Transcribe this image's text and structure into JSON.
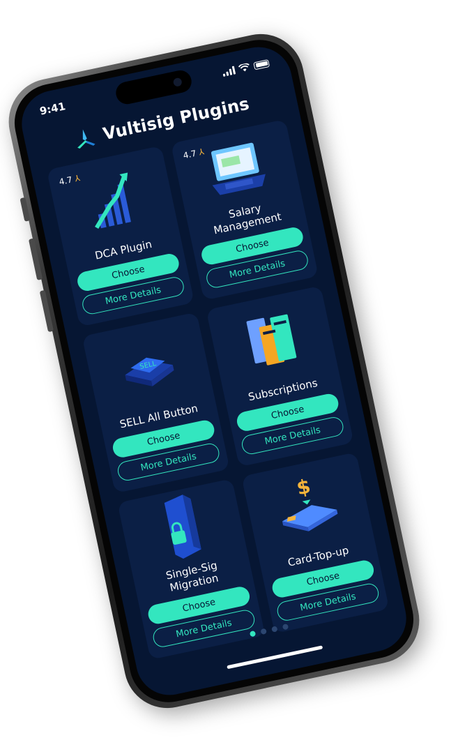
{
  "status_bar": {
    "time": "9:41"
  },
  "header": {
    "title": "Vultisig Plugins",
    "logo_icon": "vultisig-logo-icon"
  },
  "plugins": [
    {
      "name": "DCA Plugin",
      "rating": "4.7",
      "icon": "chart-arrow-icon"
    },
    {
      "name": "Salary Management",
      "rating": "4.7",
      "icon": "laptop-payment-icon"
    },
    {
      "name": "SELL All Button",
      "rating": "",
      "icon": "sell-button-icon"
    },
    {
      "name": "Subscriptions",
      "rating": "",
      "icon": "tickets-icon"
    },
    {
      "name": "Single-Sig Migration",
      "rating": "",
      "icon": "locked-box-icon"
    },
    {
      "name": "Card-Top-up",
      "rating": "",
      "icon": "credit-card-dollar-icon"
    }
  ],
  "buttons": {
    "choose": "Choose",
    "details": "More Details"
  },
  "pagination": {
    "total": 4,
    "active": 0
  },
  "colors": {
    "background": "#061633",
    "card": "#0b1f45",
    "accent": "#33e6bf",
    "star": "#f5b43b"
  }
}
